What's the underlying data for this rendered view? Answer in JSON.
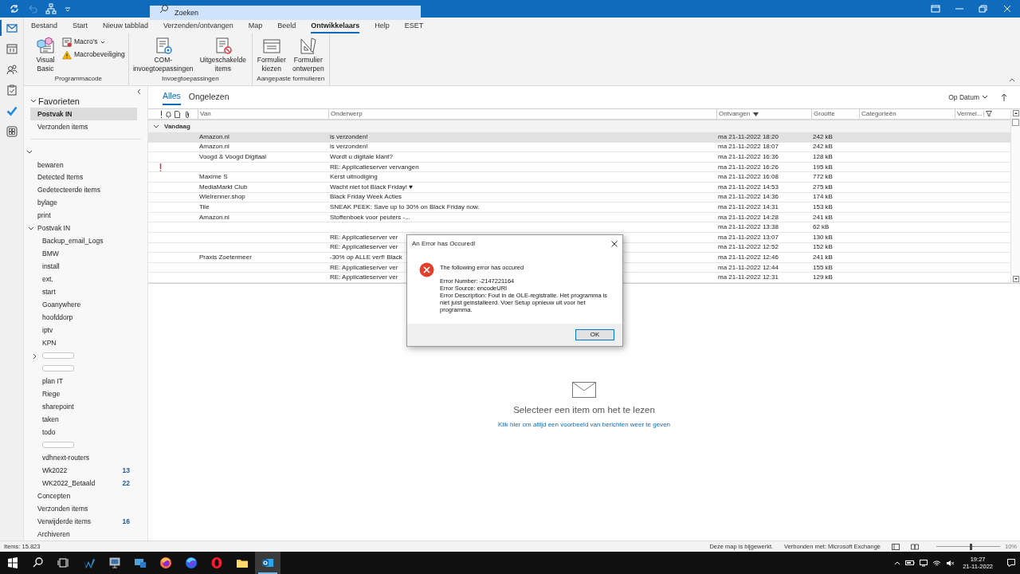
{
  "title_bar": {
    "search_placeholder": "Zoeken"
  },
  "ribbon_tabs": [
    {
      "label": "Bestand",
      "selected": false
    },
    {
      "label": "Start",
      "selected": false
    },
    {
      "label": "Nieuw tabblad",
      "selected": false
    },
    {
      "label": "Verzenden/ontvangen",
      "selected": false
    },
    {
      "label": "Map",
      "selected": false
    },
    {
      "label": "Beeld",
      "selected": false
    },
    {
      "label": "Ontwikkelaars",
      "selected": true
    },
    {
      "label": "Help",
      "selected": false
    },
    {
      "label": "ESET",
      "selected": false
    }
  ],
  "ribbon_groups": [
    {
      "label": "Programmacode",
      "buttons": [
        {
          "kind": "large",
          "label": "Visual Basic",
          "dropdown": false
        },
        {
          "kind": "small",
          "label": "Macro's",
          "dropdown": true
        },
        {
          "kind": "small",
          "label": "Macrobeveiliging",
          "dropdown": false
        }
      ]
    },
    {
      "label": "Invoegtoepassingen",
      "buttons": [
        {
          "kind": "large",
          "label": "COM-invoegtoepassingen",
          "dropdown": false
        },
        {
          "kind": "large",
          "label": "Uitgeschakelde items",
          "dropdown": false
        }
      ]
    },
    {
      "label": "Aangepaste formulieren",
      "buttons": [
        {
          "kind": "large",
          "label": "Formulier kiezen",
          "dropdown": false
        },
        {
          "kind": "large",
          "label": "Formulier ontwerpen",
          "dropdown": false
        }
      ]
    }
  ],
  "sidebar": {
    "favorites": {
      "label": "Favorieten",
      "expanded": true,
      "items": [
        {
          "label": "Postvak IN",
          "selected": true
        },
        {
          "label": "Verzonden items",
          "selected": false
        }
      ]
    },
    "account": {
      "expanded": true,
      "children": [
        {
          "label": "bewaren"
        },
        {
          "label": "Detected Items"
        },
        {
          "label": "Gedetecteerde items"
        },
        {
          "label": "bylage"
        },
        {
          "label": "print"
        },
        {
          "label": "Postvak IN",
          "expanded": true,
          "children": [
            {
              "label": "Backup_email_Logs"
            },
            {
              "label": "BMW"
            },
            {
              "label": "install"
            },
            {
              "label": "ext."
            },
            {
              "label": "start"
            },
            {
              "label": "Goanywhere"
            },
            {
              "label": "hoofddorp"
            },
            {
              "label": "iptv"
            },
            {
              "label": "KPN"
            },
            {
              "expanded": false,
              "redacted": true
            },
            {
              "redacted": true
            },
            {
              "label": "plan IT"
            },
            {
              "label": "Riege"
            },
            {
              "label": "sharepoint"
            },
            {
              "label": "taken"
            },
            {
              "label": "todo"
            },
            {
              "redacted": true
            },
            {
              "label": "vdhnext-routers"
            },
            {
              "label": "Wk2022",
              "count": "13"
            },
            {
              "label": "WK2022_Betaald",
              "count": "22"
            }
          ]
        },
        {
          "label": "Concepten"
        },
        {
          "label": "Verzonden items"
        },
        {
          "label": "Verwijderde items",
          "count": "16"
        },
        {
          "label": "Archiveren"
        }
      ]
    }
  },
  "mail_list": {
    "filters": [
      {
        "label": "Alles",
        "selected": true
      },
      {
        "label": "Ongelezen",
        "selected": false
      }
    ],
    "sort_label": "Op Datum",
    "columns": [
      {
        "label": "Van",
        "sorted": false
      },
      {
        "label": "Onderwerp",
        "sorted": false
      },
      {
        "label": "Ontvangen",
        "sorted": true
      },
      {
        "label": "Grootte",
        "sorted": false
      },
      {
        "label": "Categorieën",
        "sorted": false
      },
      {
        "label": "Vermel...",
        "sorted": false
      }
    ],
    "group": {
      "label": "Vandaag",
      "expanded": true
    },
    "rows": [
      {
        "important": false,
        "selected": true,
        "from": "Amazon.nl",
        "subject": "is verzonden!",
        "received": "ma 21-11-2022 18:20",
        "size": "242 kB"
      },
      {
        "important": false,
        "selected": false,
        "from": "Amazon.nl",
        "subject": "is verzonden!",
        "received": "ma 21-11-2022 18:07",
        "size": "242 kB"
      },
      {
        "important": false,
        "selected": false,
        "from": "Voogd & Voogd Digitaal",
        "subject": "Wordt u digitale klant?",
        "received": "ma 21-11-2022 16:36",
        "size": "128 kB"
      },
      {
        "important": true,
        "selected": false,
        "subject": "RE: Applicatieserver vervangen",
        "received": "ma 21-11-2022 16:26",
        "size": "195 kB"
      },
      {
        "important": false,
        "selected": false,
        "from": "Maxime S",
        "subject": "Kerst uitnodiging",
        "received": "ma 21-11-2022 16:08",
        "size": "772 kB"
      },
      {
        "important": false,
        "selected": false,
        "from": "MediaMarkt Club",
        "subject": "Wacht niet tot Black Friday! ♥",
        "received": "ma 21-11-2022 14:53",
        "size": "275 kB"
      },
      {
        "important": false,
        "selected": false,
        "from": "Wielrenner.shop",
        "subject": "Black Friday Week Acties",
        "received": "ma 21-11-2022 14:36",
        "size": "174 kB"
      },
      {
        "important": false,
        "selected": false,
        "from": "Tile",
        "subject": "SNEAK PEEK: Save up to 30% on Black Friday now.",
        "received": "ma 21-11-2022 14:31",
        "size": "153 kB"
      },
      {
        "important": false,
        "selected": false,
        "from": "Amazon.nl",
        "subject": "Stoffenboek voor peuters -...",
        "received": "ma 21-11-2022 14:28",
        "size": "241 kB"
      },
      {
        "important": false,
        "selected": false,
        "received": "ma 21-11-2022 13:38",
        "size": "62 kB"
      },
      {
        "important": false,
        "selected": false,
        "subject": "RE: Applicatieserver ver",
        "received": "ma 21-11-2022 13:07",
        "size": "130 kB"
      },
      {
        "important": false,
        "selected": false,
        "subject": "RE: Applicatieserver ver",
        "received": "ma 21-11-2022 12:52",
        "size": "152 kB"
      },
      {
        "important": false,
        "selected": false,
        "from": "Praxis Zoetermeer",
        "subject": "-30% op ALLE verf! Black",
        "received": "ma 21-11-2022 12:46",
        "size": "241 kB"
      },
      {
        "important": false,
        "selected": false,
        "subject": "RE: Applicatieserver ver",
        "received": "ma 21-11-2022 12:44",
        "size": "155 kB"
      },
      {
        "important": false,
        "selected": false,
        "subject": "RE: Applicatieserver ver",
        "received": "ma 21-11-2022 12:31",
        "size": "129 kB"
      }
    ]
  },
  "reading_pane": {
    "message": "Selecteer een item om het te lezen",
    "link": "Klik hier om altijd een voorbeeld van berichten weer te geven"
  },
  "dialog": {
    "title": "An Error has Occured!",
    "heading": "The following error has occured",
    "lines": [
      "Error Number: -2147221164",
      "Error Source: encodeURI",
      "Error Description: Fout in de OLE-registratie. Het programma is niet juist geinstalleerd. Voer Setup opnieuw uit voor het programma."
    ],
    "button": "OK"
  },
  "status_bar": {
    "items": "Items: 15.823",
    "state": "Deze map is bijgewerkt.",
    "connection": "Verbonden met: Microsoft Exchange",
    "zoom": {
      "level": 0.55
    },
    "zoom_label": "10%"
  },
  "taskbar": {
    "time": "19:27",
    "date": "21-11-2022"
  }
}
